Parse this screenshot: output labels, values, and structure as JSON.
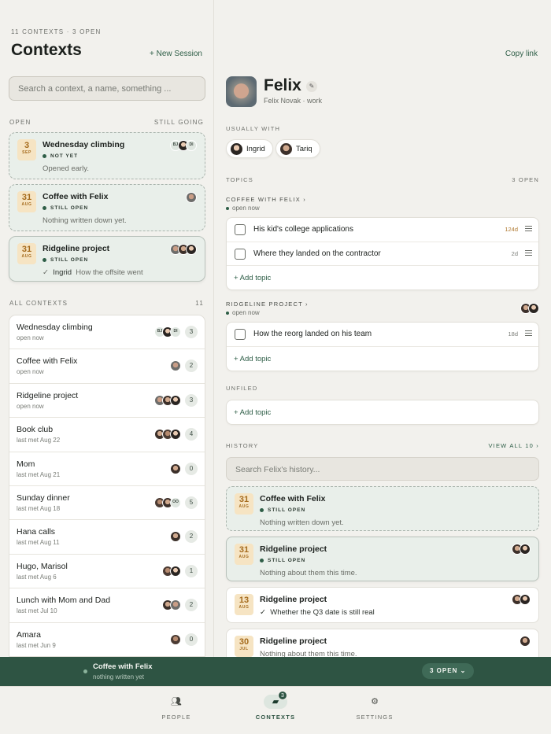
{
  "left": {
    "eyebrow": "11 CONTEXTS · 3 OPEN",
    "title": "Contexts",
    "new_session": "+ New Session",
    "search_placeholder": "Search a context, a name, something ...",
    "open_label": "OPEN",
    "open_right": "STILL GOING",
    "open_cards": [
      {
        "day": "3",
        "month": "SEP",
        "title": "Wednesday climbing",
        "status": "NOT YET",
        "note": "Opened early.",
        "avatars": [
          "BJ",
          "ingrid",
          "DI"
        ]
      },
      {
        "day": "31",
        "month": "AUG",
        "title": "Coffee with Felix",
        "status": "STILL OPEN",
        "note": "Nothing written down yet.",
        "avatars": [
          "felix"
        ]
      },
      {
        "day": "31",
        "month": "AUG",
        "title": "Ridgeline project",
        "status": "STILL OPEN",
        "note_person": "Ingrid",
        "note": "How the offsite went",
        "avatars": [
          "felix",
          "tariq",
          "ingrid"
        ]
      }
    ],
    "all_label": "ALL CONTEXTS",
    "all_count": "11",
    "contexts": [
      {
        "name": "Wednesday climbing",
        "sub": "open now",
        "count": "3"
      },
      {
        "name": "Coffee with Felix",
        "sub": "open now",
        "count": "2"
      },
      {
        "name": "Ridgeline project",
        "sub": "open now",
        "count": "3"
      },
      {
        "name": "Book club",
        "sub": "last met Aug 22",
        "count": "4"
      },
      {
        "name": "Mom",
        "sub": "last met Aug 21",
        "count": "0"
      },
      {
        "name": "Sunday dinner",
        "sub": "last met Aug 18",
        "count": "5"
      },
      {
        "name": "Hana calls",
        "sub": "last met Aug 11",
        "count": "2"
      },
      {
        "name": "Hugo, Marisol",
        "sub": "last met Aug 6",
        "count": "1"
      },
      {
        "name": "Lunch with Mom and Dad",
        "sub": "last met Jul 10",
        "count": "2"
      },
      {
        "name": "Amara",
        "sub": "last met Jun 9",
        "count": "0"
      }
    ]
  },
  "right": {
    "copy_link": "Copy link",
    "name": "Felix",
    "sub": "Felix Novak · work",
    "usually_with_label": "USUALLY WITH",
    "chips": [
      "Ingrid",
      "Tariq"
    ],
    "topics_label": "TOPICS",
    "topics_open": "3 OPEN",
    "group1": {
      "title": "COFFEE WITH FELIX ›",
      "sub": "open now",
      "topics": [
        {
          "text": "His kid's college applications",
          "age": "124d"
        },
        {
          "text": "Where they landed on the contractor",
          "age": "2d"
        }
      ]
    },
    "group2": {
      "title": "RIDGELINE PROJECT ›",
      "sub": "open now",
      "topics": [
        {
          "text": "How the reorg landed on his team",
          "age": "18d"
        }
      ]
    },
    "add_topic": "+ Add topic",
    "unfiled_label": "UNFILED",
    "history_label": "HISTORY",
    "view_all": "VIEW ALL 10 ›",
    "history_search": "Search Felix's history...",
    "history": [
      {
        "day": "31",
        "month": "AUG",
        "title": "Coffee with Felix",
        "status": "STILL OPEN",
        "note": "Nothing written down yet."
      },
      {
        "day": "31",
        "month": "AUG",
        "title": "Ridgeline project",
        "status": "STILL OPEN",
        "note": "Nothing about them this time."
      },
      {
        "day": "13",
        "month": "AUG",
        "title": "Ridgeline project",
        "note": "Whether the Q3 date is still real"
      },
      {
        "day": "30",
        "month": "JUL",
        "title": "Ridgeline project",
        "note": "Nothing about them this time."
      }
    ]
  },
  "now_bar": {
    "title": "Coffee with Felix",
    "sub": "nothing written yet",
    "pill": "3 OPEN ⌄"
  },
  "tabs": {
    "people": "PEOPLE",
    "contexts": "CONTEXTS",
    "contexts_badge": "3",
    "settings": "SETTINGS"
  },
  "colors": {
    "accent": "#2e5443",
    "date_bg": "#f6e4c3",
    "open_card_bg": "#e9efea"
  }
}
